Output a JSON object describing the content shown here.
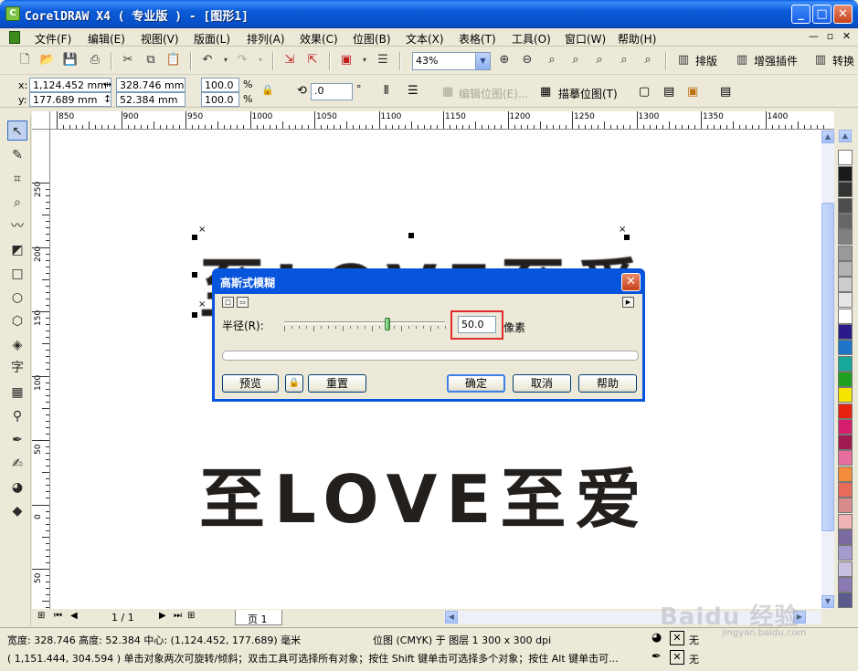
{
  "window": {
    "title": "CorelDRAW X4 ( 专业版 ) - [图形1]",
    "app_icon": "coreldraw-icon"
  },
  "menu": [
    "文件(F)",
    "编辑(E)",
    "视图(V)",
    "版面(L)",
    "排列(A)",
    "效果(C)",
    "位图(B)",
    "文本(X)",
    "表格(T)",
    "工具(O)",
    "窗口(W)",
    "帮助(H)"
  ],
  "toolbar": {
    "zoom": "43%",
    "layout_btn": "排版",
    "plugin_btn": "增强插件",
    "convert_btn": "转换"
  },
  "propbar": {
    "x_label": "x:",
    "y_label": "y:",
    "x_value": "1,124.452 mm",
    "y_value": "177.689 mm",
    "width_value": "328.746 mm",
    "height_value": "52.384 mm",
    "scale_w": "100.0",
    "scale_h": "100.0",
    "percent": "%",
    "rotation": ".0",
    "degree": "°",
    "edit_bitmap": "编辑位图(E)...",
    "trace_bitmap": "描摹位图(T)"
  },
  "rulers": {
    "h_ticks": [
      "850",
      "900",
      "950",
      "1000",
      "1050",
      "1100",
      "1150",
      "1200",
      "1250",
      "1300",
      "1350",
      "1400"
    ],
    "v_ticks": [
      "250",
      "200",
      "150",
      "100",
      "50",
      "0",
      "50"
    ]
  },
  "canvas": {
    "top_text": "至LOVE至爱",
    "bottom_text": "至LOVE至爱"
  },
  "dialog": {
    "title": "高斯式模糊",
    "radius_label": "半径(R):",
    "radius_value": "50.0",
    "unit": "像素",
    "preview": "预览",
    "reset": "重置",
    "ok": "确定",
    "cancel": "取消",
    "help": "帮助"
  },
  "pagebar": {
    "page_count": "1 / 1",
    "page_tab": "页 1"
  },
  "palette": [
    "#ffffff",
    "#1a1a1a",
    "#333333",
    "#4d4d4d",
    "#666666",
    "#808080",
    "#999999",
    "#b3b3b3",
    "#cccccc",
    "#e6e6e6",
    "#ffffff",
    "#2b1a8a",
    "#1e74c8",
    "#17a89a",
    "#20a020",
    "#f5e400",
    "#e82010",
    "#d61e6e",
    "#a01a50",
    "#e86ea0",
    "#f28c3a",
    "#e86a5a",
    "#d98c8c",
    "#f0b4b4",
    "#7a6aa0",
    "#a49acc",
    "#c8c0e0",
    "#8c7ab4",
    "#5a5a8c"
  ],
  "status": {
    "line1_left": "宽度: 328.746 高度: 52.384 中心: (1,124.452, 177.689) 毫米",
    "line1_mid": "位图 (CMYK) 于 图层 1 300 x 300 dpi",
    "line2": "( 1,151.444, 304.594 ) 单击对象两次可旋转/倾斜；双击工具可选择所有对象；按住 Shift 键单击可选择多个对象；按住 Alt 键单击可...",
    "fill_none": "无",
    "outline_none": "无"
  }
}
